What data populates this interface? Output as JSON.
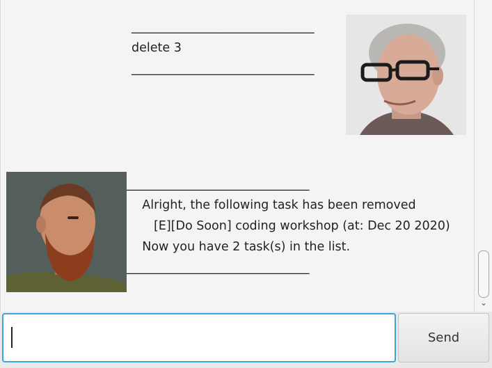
{
  "chat": {
    "user_message": "______________________________\ndelete 3\n______________________________",
    "bot_message": "______________________________\n    Alright, the following task has been removed\n       [E][Do Soon] coding workshop (at: Dec 20 2020)\n    Now you have 2 task(s) in the list.\n______________________________"
  },
  "input": {
    "value": "",
    "placeholder": ""
  },
  "send_button": {
    "label": "Send"
  },
  "colors": {
    "background": "#f4f4f4",
    "input_focus_border": "#3aa5db"
  },
  "icons": {
    "scroll_down": "chevron-down-icon"
  }
}
